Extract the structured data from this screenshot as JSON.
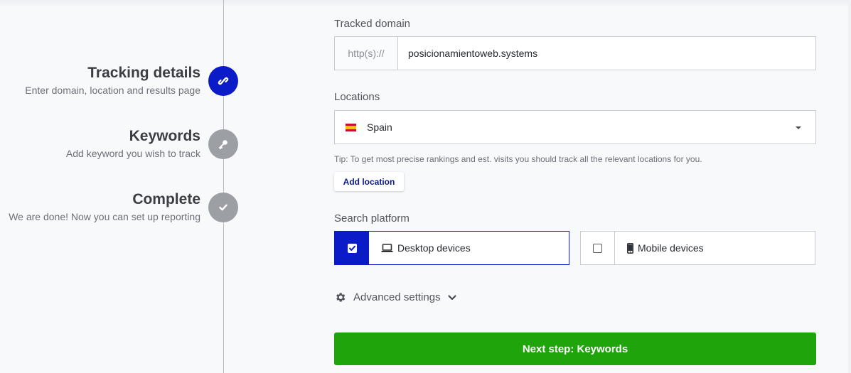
{
  "steps": [
    {
      "title": "Tracking details",
      "subtitle": "Enter domain, location and results page",
      "state": "active",
      "icon": "link-icon"
    },
    {
      "title": "Keywords",
      "subtitle": "Add keyword you wish to track",
      "state": "inactive",
      "icon": "key-icon"
    },
    {
      "title": "Complete",
      "subtitle": "We are done! Now you can set up reporting",
      "state": "inactive",
      "icon": "check-icon"
    }
  ],
  "form": {
    "domain_label": "Tracked domain",
    "domain_prefix": "http(s)://",
    "domain_value": "posicionamientoweb.systems",
    "locations_label": "Locations",
    "location_value": "Spain",
    "location_flag": "flag-es",
    "tip": "Tip: To get most precise rankings and est. visits you should track all the relevant locations for you.",
    "add_location_label": "Add location",
    "platform_label": "Search platform",
    "platforms": [
      {
        "label": "Desktop devices",
        "checked": true,
        "icon": "laptop-icon"
      },
      {
        "label": "Mobile devices",
        "checked": false,
        "icon": "mobile-icon"
      }
    ],
    "advanced_label": "Advanced settings",
    "next_label": "Next step: Keywords"
  },
  "colors": {
    "primary": "#0b1bc8",
    "success": "#1fa40c",
    "inactive": "#9c9fa4",
    "background": "#f8f9fb"
  }
}
